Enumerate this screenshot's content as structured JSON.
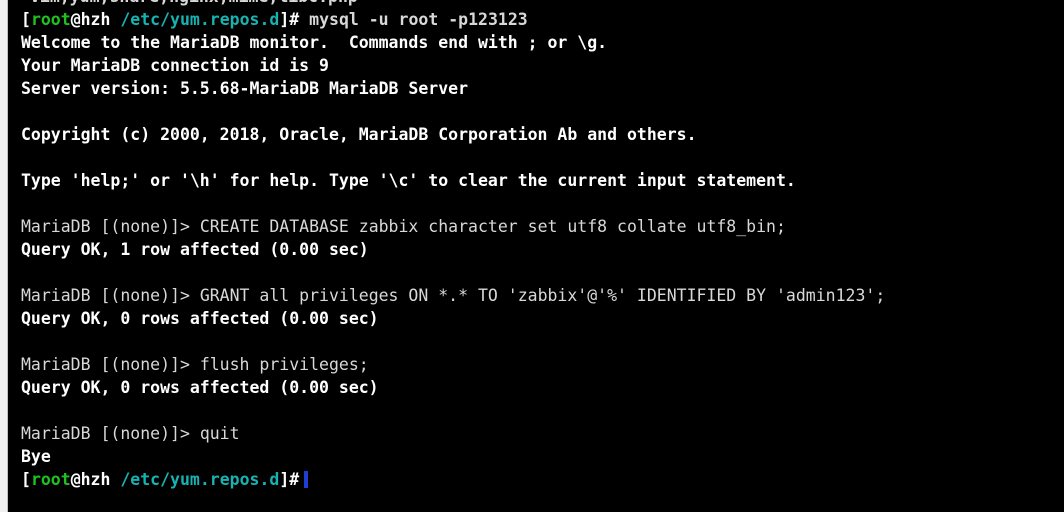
{
  "terminal": {
    "background_color": "#000000",
    "default_text_color": "#d8d8d8",
    "bold_text_color": "#ffffff",
    "prompt_user_color": "#20c020",
    "prompt_path_color": "#18b2b2",
    "cursor_color": "#1f3fd0",
    "gutter_color": "#f0f0f0",
    "clipped_top_line": "vim,yum,share,nginx,mime,libc.php"
  },
  "prompt": {
    "bracket_open": "[",
    "user": "root",
    "at_host": "@hzh",
    "space": " ",
    "path": "/etc/yum.repos.d",
    "bracket_close": "]#",
    "mariadb_prompt": "MariaDB [(none)]> "
  },
  "commands": {
    "login": "mysql -u root -p123123",
    "create_database": "CREATE DATABASE zabbix character set utf8 collate utf8_bin;",
    "grant": "GRANT all privileges ON *.* TO 'zabbix'@'%' IDENTIFIED BY 'admin123';",
    "flush": "flush privileges;",
    "quit": "quit"
  },
  "output": {
    "welcome": "Welcome to the MariaDB monitor.  Commands end with ; or \\g.",
    "connection_id": "Your MariaDB connection id is 9",
    "server_version": "Server version: 5.5.68-MariaDB MariaDB Server",
    "copyright": "Copyright (c) 2000, 2018, Oracle, MariaDB Corporation Ab and others.",
    "help_hint": "Type 'help;' or '\\h' for help. Type '\\c' to clear the current input statement.",
    "query_ok_1_row": "Query OK, 1 row affected (0.00 sec)",
    "query_ok_0_rows_grant": "Query OK, 0 rows affected (0.00 sec)",
    "query_ok_0_rows_flush": "Query OK, 0 rows affected (0.00 sec)",
    "bye": "Bye"
  }
}
